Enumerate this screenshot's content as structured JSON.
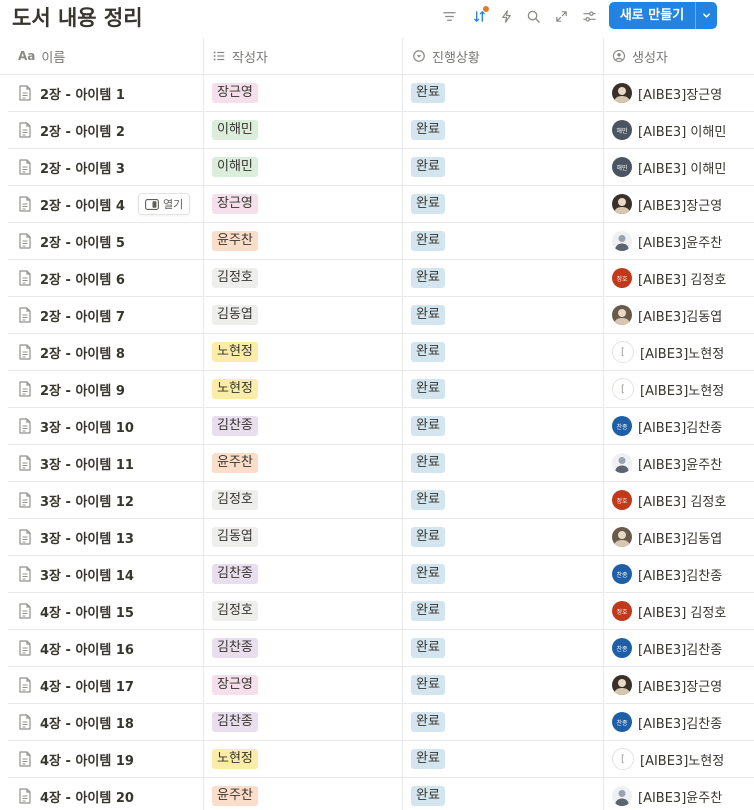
{
  "page": {
    "title": "도서 내용 정리"
  },
  "toolbar": {
    "icons": [
      "filter-icon",
      "sort-icon",
      "automation-icon",
      "search-icon",
      "expand-icon",
      "settings-icon"
    ],
    "new_button_label": "새로 만들기",
    "accent_color": "#2383e2"
  },
  "columns": [
    {
      "label": "이름",
      "icon": "title-icon"
    },
    {
      "label": "작성자",
      "icon": "list-icon"
    },
    {
      "label": "진행상황",
      "icon": "status-icon"
    },
    {
      "label": "생성자",
      "icon": "person-icon"
    }
  ],
  "row_actions": {
    "open_label": "열기"
  },
  "tag_colors": {
    "장근영": "#f4dfeb",
    "이해민": "#dbeddb",
    "윤주찬": "#fadec9",
    "김정호": "#eeeeed",
    "김동엽": "#eeeeed",
    "노현정": "#fbeda7",
    "김찬종": "#e8deee",
    "완료": "#d3e5ef"
  },
  "avatars": {
    "[AIBE3]장근영": {
      "type": "photo",
      "color": "#3b2f2a"
    },
    "[AIBE3] 이해민": {
      "type": "initials",
      "text": "해민",
      "color": "#4a5561"
    },
    "[AIBE3]윤주찬": {
      "type": "cartoon",
      "color": "#9aa2ad"
    },
    "[AIBE3] 김정호": {
      "type": "initials",
      "text": "정호",
      "color": "#c0391b"
    },
    "[AIBE3]김동엽": {
      "type": "photo",
      "color": "#6a5a4a"
    },
    "[AIBE3]노현정": {
      "type": "bracket",
      "text": "[",
      "color": "#ffffff"
    },
    "[AIBE3]김찬종": {
      "type": "initials",
      "text": "찬종",
      "color": "#1f5fa8"
    }
  },
  "rows": [
    {
      "name": "2장 - 아이템 1",
      "author": "장근영",
      "status": "완료",
      "creator": "[AIBE3]장근영"
    },
    {
      "name": "2장 - 아이템 2",
      "author": "이해민",
      "status": "완료",
      "creator": "[AIBE3] 이해민"
    },
    {
      "name": "2장 - 아이템 3",
      "author": "이해민",
      "status": "완료",
      "creator": "[AIBE3] 이해민"
    },
    {
      "name": "2장 - 아이템 4",
      "author": "장근영",
      "status": "완료",
      "creator": "[AIBE3]장근영",
      "hovered": true
    },
    {
      "name": "2장 - 아이템 5",
      "author": "윤주찬",
      "status": "완료",
      "creator": "[AIBE3]윤주찬"
    },
    {
      "name": "2장 - 아이템 6",
      "author": "김정호",
      "status": "완료",
      "creator": "[AIBE3] 김정호"
    },
    {
      "name": "2장 - 아이템 7",
      "author": "김동엽",
      "status": "완료",
      "creator": "[AIBE3]김동엽"
    },
    {
      "name": "2장 - 아이템 8",
      "author": "노현정",
      "status": "완료",
      "creator": "[AIBE3]노현정"
    },
    {
      "name": "2장 - 아이템 9",
      "author": "노현정",
      "status": "완료",
      "creator": "[AIBE3]노현정"
    },
    {
      "name": "3장 - 아이템 10",
      "author": "김찬종",
      "status": "완료",
      "creator": "[AIBE3]김찬종"
    },
    {
      "name": "3장 - 아이템 11",
      "author": "윤주찬",
      "status": "완료",
      "creator": "[AIBE3]윤주찬"
    },
    {
      "name": "3장 - 아이템 12",
      "author": "김정호",
      "status": "완료",
      "creator": "[AIBE3] 김정호"
    },
    {
      "name": "3장 - 아이템 13",
      "author": "김동엽",
      "status": "완료",
      "creator": "[AIBE3]김동엽"
    },
    {
      "name": "3장 - 아이템 14",
      "author": "김찬종",
      "status": "완료",
      "creator": "[AIBE3]김찬종"
    },
    {
      "name": "4장 - 아이템 15",
      "author": "김정호",
      "status": "완료",
      "creator": "[AIBE3] 김정호"
    },
    {
      "name": "4장 - 아이템 16",
      "author": "김찬종",
      "status": "완료",
      "creator": "[AIBE3]김찬종"
    },
    {
      "name": "4장 - 아이템 17",
      "author": "장근영",
      "status": "완료",
      "creator": "[AIBE3]장근영"
    },
    {
      "name": "4장 - 아이템 18",
      "author": "김찬종",
      "status": "완료",
      "creator": "[AIBE3]김찬종"
    },
    {
      "name": "4장 - 아이템 19",
      "author": "노현정",
      "status": "완료",
      "creator": "[AIBE3]노현정"
    },
    {
      "name": "4장 - 아이템 20",
      "author": "윤주찬",
      "status": "완료",
      "creator": "[AIBE3]윤주찬"
    }
  ]
}
